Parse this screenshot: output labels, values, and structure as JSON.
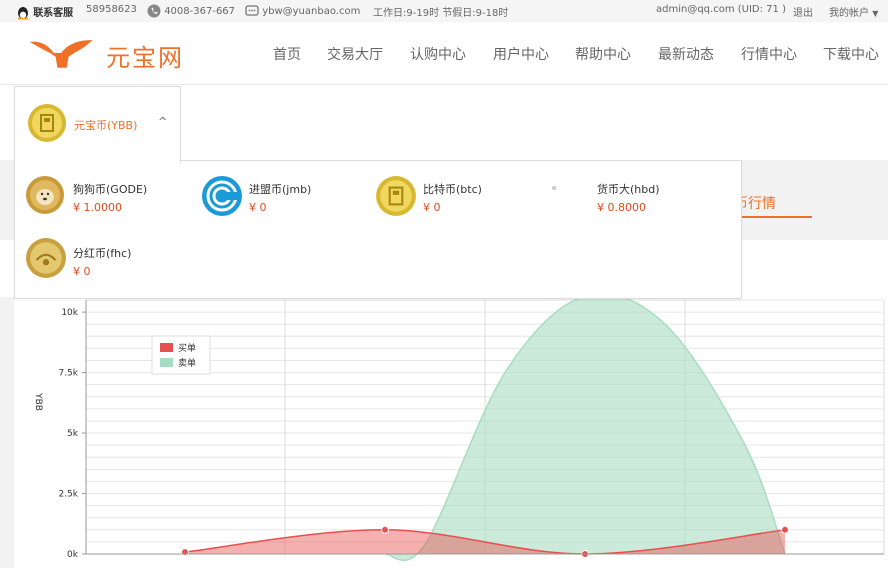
{
  "topbar": {
    "service_label": "联系客服",
    "qq": "58958623",
    "phone": "4008-367-667",
    "email": "ybw@yuanbao.com",
    "hours": "工作日:9-19时 节假日:9-18时",
    "user": "admin@qq.com (UID: 71 )",
    "logout": "退出",
    "my_account": "我的帐户"
  },
  "header": {
    "logo_text": "元宝网",
    "nav": [
      "首页",
      "交易大厅",
      "认购中心",
      "用户中心",
      "帮助中心",
      "最新动态",
      "行情中心",
      "下载中心"
    ]
  },
  "selector": {
    "label": "元宝币(YBB)",
    "chevron": "^"
  },
  "coins": [
    {
      "name": "狗狗币(GODE)",
      "price": "¥ 1.0000",
      "icon": "doge-coin-icon"
    },
    {
      "name": "进盟币(jmb)",
      "price": "¥ 0",
      "icon": "jmb-coin-icon"
    },
    {
      "name": "比特币(btc)",
      "price": "¥ 0",
      "icon": "btc-coin-icon"
    },
    {
      "name": "货币大(hbd)",
      "price": "¥ 0.8000",
      "icon": "hbd-coin-icon"
    },
    {
      "name": "分红币(fhc)",
      "price": "¥ 0",
      "icon": "fhc-coin-icon"
    }
  ],
  "tab_right": "宝币行情",
  "colors": {
    "accent": "#f07028",
    "buy": "#e8504f",
    "sell": "#a8dcc0",
    "price": "#e04a1e"
  },
  "chart_data": {
    "type": "area",
    "ylabel": "YBB",
    "yticks": [
      "0k",
      "2.5k",
      "5k",
      "7.5k",
      "10k"
    ],
    "ylim": [
      0,
      10500
    ],
    "xlim": [
      0,
      4
    ],
    "legend_position": "top-left",
    "grid": true,
    "series": [
      {
        "name": "买单",
        "color": "#e8504f",
        "points": [
          [
            0,
            80
          ],
          [
            1,
            1000
          ],
          [
            2,
            0
          ],
          [
            3,
            1000
          ]
        ]
      },
      {
        "name": "卖单",
        "color": "#a8dcc0",
        "points": [
          [
            1,
            0
          ],
          [
            1.2,
            400
          ],
          [
            1.6,
            7500
          ],
          [
            2.0,
            11000
          ],
          [
            2.4,
            9500
          ],
          [
            2.8,
            4500
          ],
          [
            3.0,
            0
          ]
        ]
      }
    ]
  }
}
